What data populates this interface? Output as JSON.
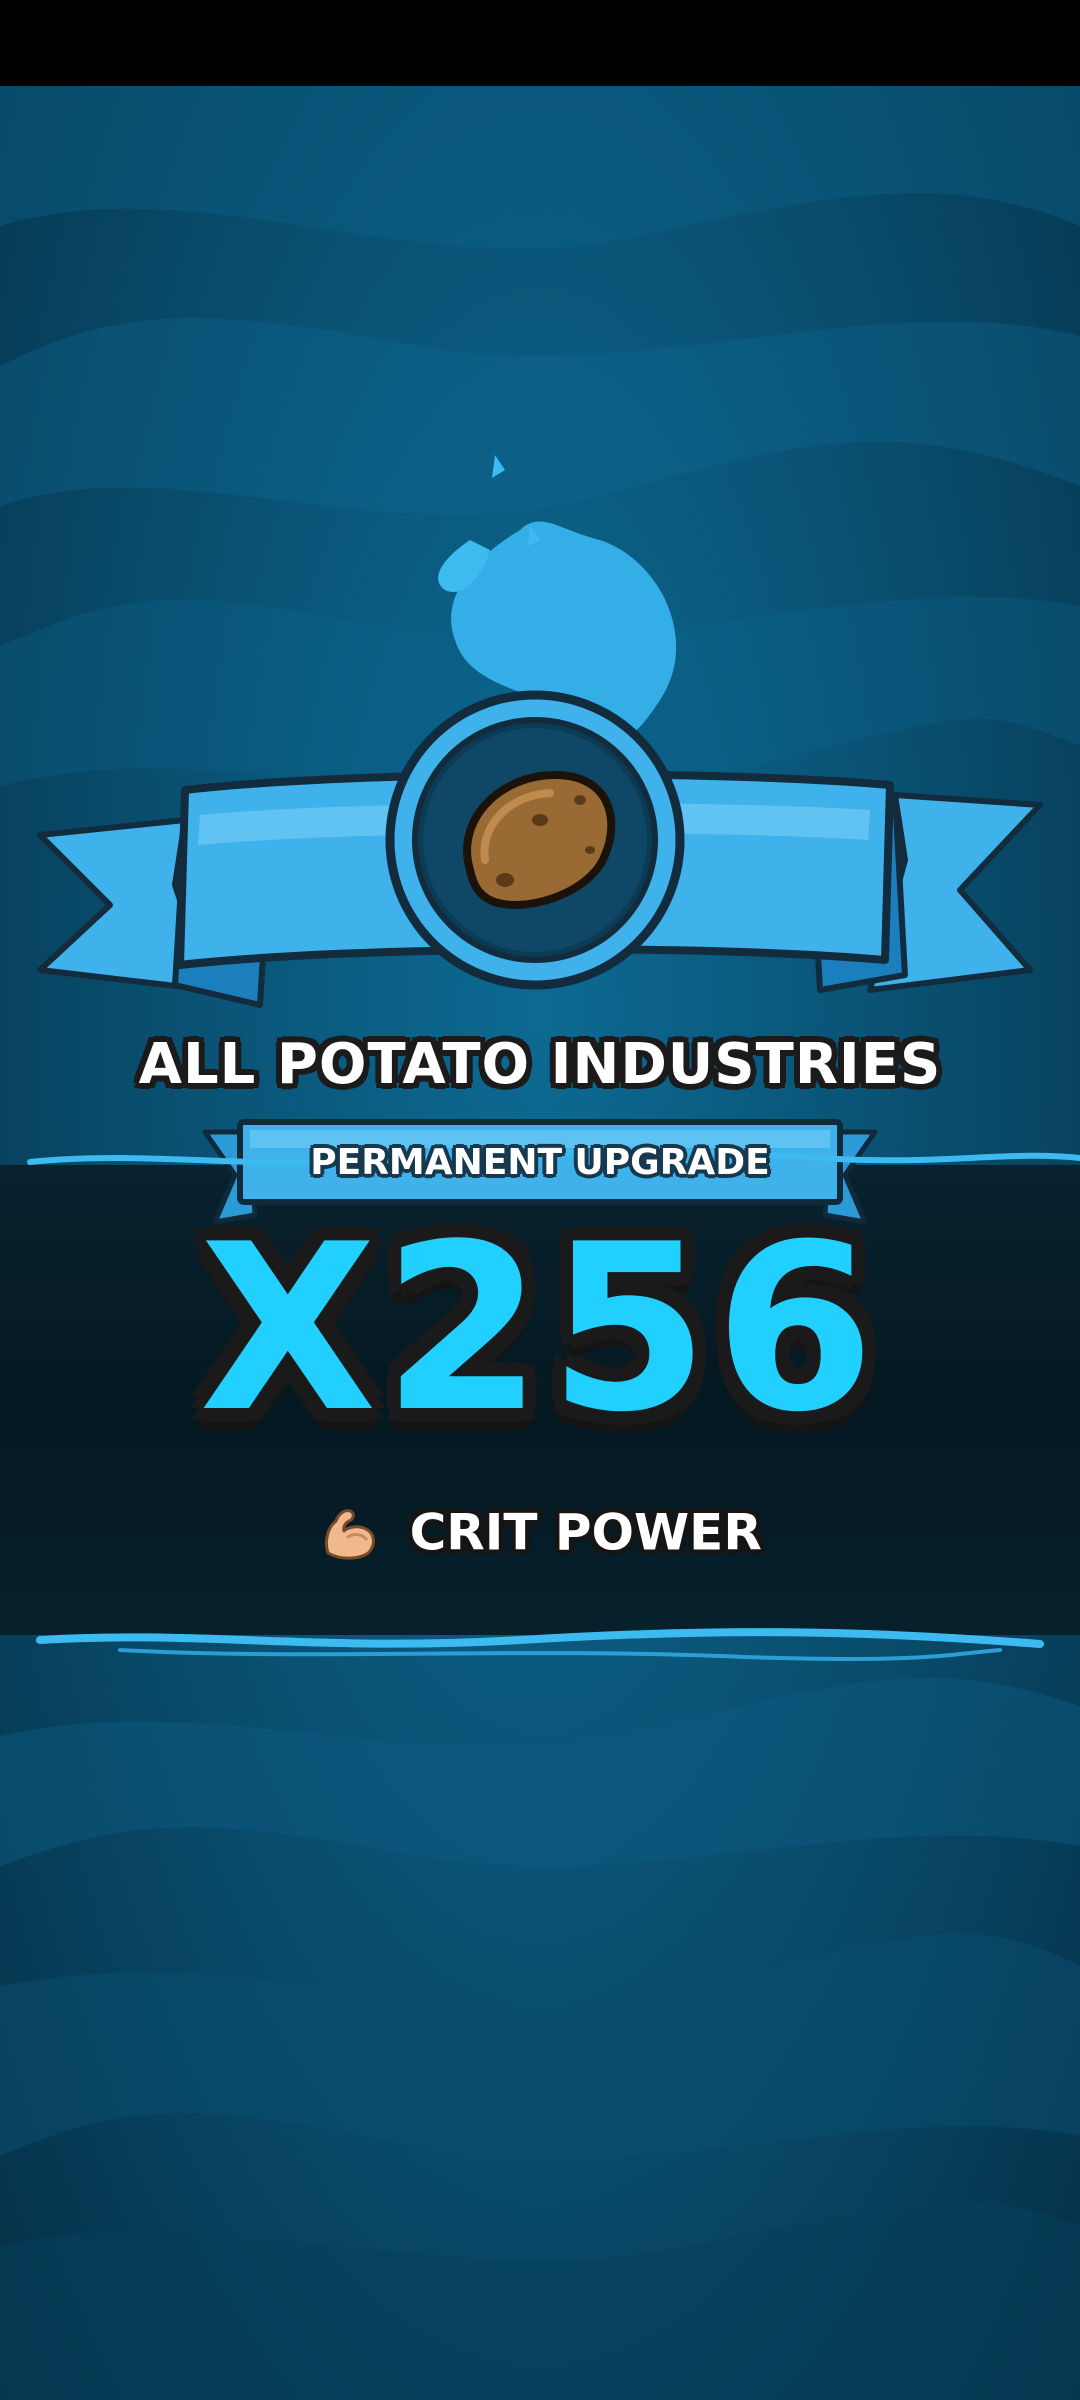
{
  "screen": "permanent-upgrade-reveal",
  "upgrade": {
    "target": "ALL POTATO INDUSTRIES",
    "kind": "PERMANENT UPGRADE",
    "multiplier": "X256",
    "bonus_icon": "flexed-biceps-icon",
    "bonus_label": "CRIT POWER",
    "item_icon": "potato-icon"
  },
  "colors": {
    "background": "#0a5578",
    "ribbon": "#3fb2ec",
    "ribbon_dark": "#1c7fbd",
    "multiplier_fill": "#22d0ff",
    "outline": "#1a1a1a",
    "potato": "#9a6a34"
  }
}
